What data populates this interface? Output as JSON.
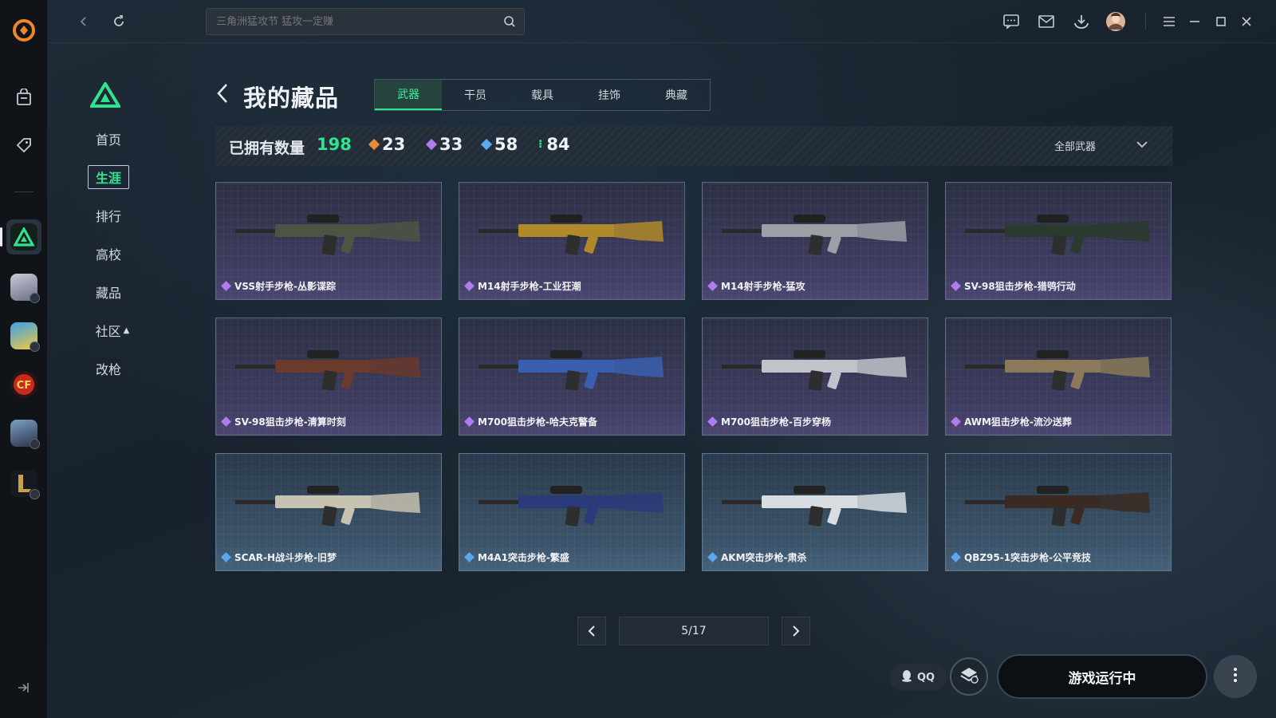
{
  "topbar": {
    "search_placeholder": "三角洲猛攻节 猛攻一定赚"
  },
  "nav": {
    "items": [
      {
        "label": "首页"
      },
      {
        "label": "生涯"
      },
      {
        "label": "排行"
      },
      {
        "label": "高校"
      },
      {
        "label": "藏品"
      },
      {
        "label": "社区"
      },
      {
        "label": "改枪"
      }
    ],
    "active": "生涯"
  },
  "page": {
    "title": "我的藏品",
    "tabs": [
      {
        "label": "武器"
      },
      {
        "label": "干员"
      },
      {
        "label": "载具"
      },
      {
        "label": "挂饰"
      },
      {
        "label": "典藏"
      }
    ],
    "active_tab": "武器"
  },
  "stats": {
    "owned_label": "已拥有数量",
    "owned_total": "198",
    "rarity_counts": [
      {
        "value": "23",
        "color": "#e58a3a"
      },
      {
        "value": "33",
        "color": "#b07cf0"
      },
      {
        "value": "58",
        "color": "#5aa8f0"
      },
      {
        "value": "84",
        "color": "#3fd98c"
      }
    ],
    "filter_label": "全部武器"
  },
  "items": [
    {
      "name": "VSS射手步枪-丛影谍踪",
      "rarity": "purple"
    },
    {
      "name": "M14射手步枪-工业狂潮",
      "rarity": "purple"
    },
    {
      "name": "M14射手步枪-猛攻",
      "rarity": "purple"
    },
    {
      "name": "SV-98狙击步枪-猎鸮行动",
      "rarity": "purple"
    },
    {
      "name": "SV-98狙击步枪-清算时刻",
      "rarity": "purple"
    },
    {
      "name": "M700狙击步枪-哈夫克警备",
      "rarity": "purple"
    },
    {
      "name": "M700狙击步枪-百步穿杨",
      "rarity": "purple"
    },
    {
      "name": "AWM狙击步枪-流沙送葬",
      "rarity": "purple"
    },
    {
      "name": "SCAR-H战斗步枪-旧梦",
      "rarity": "blue"
    },
    {
      "name": "M4A1突击步枪-繁盛",
      "rarity": "blue"
    },
    {
      "name": "AKM突击步枪-肃杀",
      "rarity": "blue"
    },
    {
      "name": "QBZ95-1突击步枪-公平竞技",
      "rarity": "blue"
    }
  ],
  "pagination": {
    "current": "5/17"
  },
  "bottom": {
    "qq_label": "QQ",
    "launch_label": "游戏运行中"
  },
  "colors": {
    "accent": "#2fe38f",
    "purple_rarity": "#b07cf0",
    "blue_rarity": "#5aa8f0"
  }
}
